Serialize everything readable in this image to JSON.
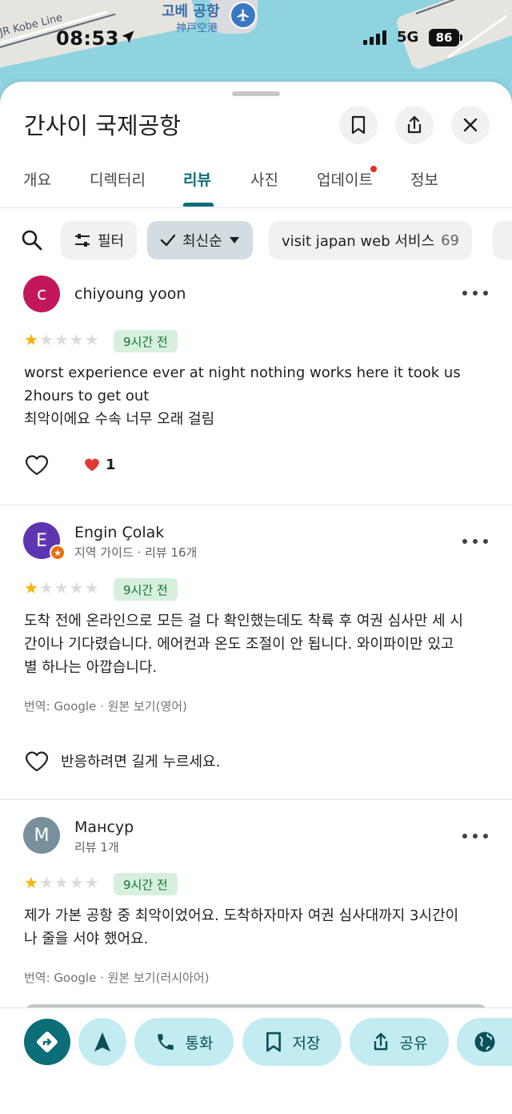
{
  "status_bar": {
    "time": "08:53",
    "network": "5G",
    "battery": "86"
  },
  "map": {
    "label_korean": "고베 공항",
    "label_japanese": "神戸空港",
    "rail_label": "JR Kobe Line"
  },
  "place": {
    "title": "간사이 국제공항"
  },
  "header_icons": [
    "bookmark-icon",
    "share-icon",
    "close-icon"
  ],
  "tabs": [
    {
      "label": "개요"
    },
    {
      "label": "디렉터리"
    },
    {
      "label": "리뷰"
    },
    {
      "label": "사진"
    },
    {
      "label": "업데이트"
    },
    {
      "label": "정보"
    }
  ],
  "active_tab": "리뷰",
  "filters": {
    "filter_label": "필터",
    "sort_label": "최신순",
    "topic_label": "visit japan web 서비스",
    "topic_count": "69"
  },
  "reviews": [
    {
      "initial": "c",
      "avatar_color": "#c2185b",
      "author": "chiyoung yoon",
      "meta": "",
      "rating": 1,
      "time": "9시간 전",
      "text": "worst experience ever at night nothing works here it took us\n2hours to get out\n최악이에요 수속 너무 오래 걸림",
      "reaction_count": "1"
    },
    {
      "initial": "E",
      "avatar_color": "#5e35b1",
      "author": "Engin Çolak",
      "meta": "지역 가이드 · 리뷰 16개",
      "rating": 1,
      "time": "9시간 전",
      "text": "도착 전에 온라인으로 모든 걸 다 확인했는데도 착륙 후 여권 심사만 세 시\n간이나 기다렸습니다. 에어컨과 온도 조절이 안 됩니다. 와이파이만 있고\n별 하나는 아깝습니다.",
      "translation_note": "번역: Google · 원본 보기(영어)",
      "react_hint": "반응하려면 길게 누르세요."
    },
    {
      "initial": "M",
      "avatar_color": "#78909c",
      "author": "Мансур",
      "meta": "리뷰 1개",
      "rating": 1,
      "time": "9시간 전",
      "text": "제가 가본 공항 중 최악이었어요. 도착하자마자 여권 심사대까지 3시간이\n나 줄을 서야 했어요.",
      "translation_note": "번역: Google · 원본 보기(러시아어)"
    }
  ],
  "actions": {
    "call": "통화",
    "save": "저장",
    "share": "공유"
  },
  "colors": {
    "accent": "#0b6e79",
    "star": "#f4b400",
    "time_badge_bg": "#d7f0dd",
    "action_bg": "#c2ecf2"
  }
}
